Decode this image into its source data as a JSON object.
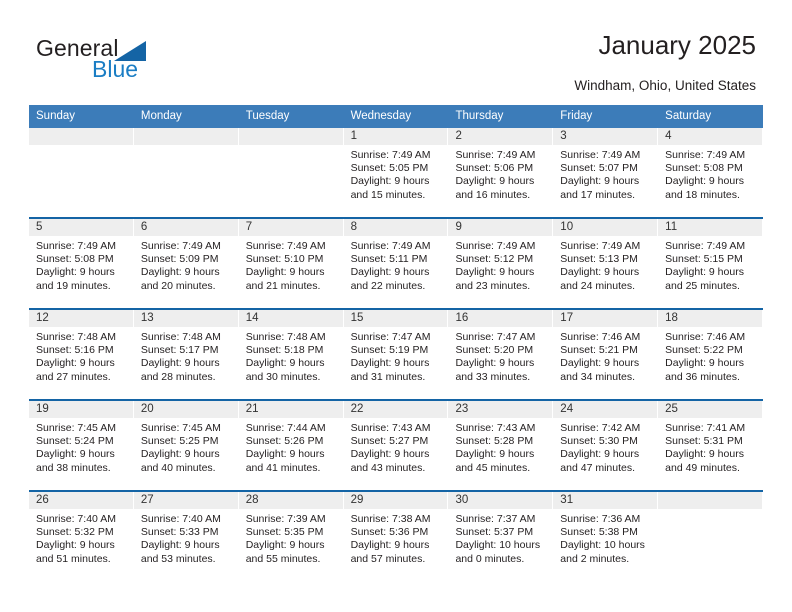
{
  "brand": {
    "name_part1": "General",
    "name_part2": "Blue",
    "triangle_color": "#1464a5",
    "blue_text_color": "#1a7dc4"
  },
  "header": {
    "title": "January 2025",
    "subtitle": "Windham, Ohio, United States"
  },
  "theme": {
    "header_bg": "#3c7cb9",
    "week_divider": "#1464a5",
    "daynum_band_bg": "#eeeeee",
    "text": "#231f20"
  },
  "calendar": {
    "day_names": [
      "Sunday",
      "Monday",
      "Tuesday",
      "Wednesday",
      "Thursday",
      "Friday",
      "Saturday"
    ],
    "weeks": [
      [
        {
          "day": "",
          "lines": []
        },
        {
          "day": "",
          "lines": []
        },
        {
          "day": "",
          "lines": []
        },
        {
          "day": "1",
          "lines": [
            "Sunrise: 7:49 AM",
            "Sunset: 5:05 PM",
            "Daylight: 9 hours",
            "and 15 minutes."
          ]
        },
        {
          "day": "2",
          "lines": [
            "Sunrise: 7:49 AM",
            "Sunset: 5:06 PM",
            "Daylight: 9 hours",
            "and 16 minutes."
          ]
        },
        {
          "day": "3",
          "lines": [
            "Sunrise: 7:49 AM",
            "Sunset: 5:07 PM",
            "Daylight: 9 hours",
            "and 17 minutes."
          ]
        },
        {
          "day": "4",
          "lines": [
            "Sunrise: 7:49 AM",
            "Sunset: 5:08 PM",
            "Daylight: 9 hours",
            "and 18 minutes."
          ]
        }
      ],
      [
        {
          "day": "5",
          "lines": [
            "Sunrise: 7:49 AM",
            "Sunset: 5:08 PM",
            "Daylight: 9 hours",
            "and 19 minutes."
          ]
        },
        {
          "day": "6",
          "lines": [
            "Sunrise: 7:49 AM",
            "Sunset: 5:09 PM",
            "Daylight: 9 hours",
            "and 20 minutes."
          ]
        },
        {
          "day": "7",
          "lines": [
            "Sunrise: 7:49 AM",
            "Sunset: 5:10 PM",
            "Daylight: 9 hours",
            "and 21 minutes."
          ]
        },
        {
          "day": "8",
          "lines": [
            "Sunrise: 7:49 AM",
            "Sunset: 5:11 PM",
            "Daylight: 9 hours",
            "and 22 minutes."
          ]
        },
        {
          "day": "9",
          "lines": [
            "Sunrise: 7:49 AM",
            "Sunset: 5:12 PM",
            "Daylight: 9 hours",
            "and 23 minutes."
          ]
        },
        {
          "day": "10",
          "lines": [
            "Sunrise: 7:49 AM",
            "Sunset: 5:13 PM",
            "Daylight: 9 hours",
            "and 24 minutes."
          ]
        },
        {
          "day": "11",
          "lines": [
            "Sunrise: 7:49 AM",
            "Sunset: 5:15 PM",
            "Daylight: 9 hours",
            "and 25 minutes."
          ]
        }
      ],
      [
        {
          "day": "12",
          "lines": [
            "Sunrise: 7:48 AM",
            "Sunset: 5:16 PM",
            "Daylight: 9 hours",
            "and 27 minutes."
          ]
        },
        {
          "day": "13",
          "lines": [
            "Sunrise: 7:48 AM",
            "Sunset: 5:17 PM",
            "Daylight: 9 hours",
            "and 28 minutes."
          ]
        },
        {
          "day": "14",
          "lines": [
            "Sunrise: 7:48 AM",
            "Sunset: 5:18 PM",
            "Daylight: 9 hours",
            "and 30 minutes."
          ]
        },
        {
          "day": "15",
          "lines": [
            "Sunrise: 7:47 AM",
            "Sunset: 5:19 PM",
            "Daylight: 9 hours",
            "and 31 minutes."
          ]
        },
        {
          "day": "16",
          "lines": [
            "Sunrise: 7:47 AM",
            "Sunset: 5:20 PM",
            "Daylight: 9 hours",
            "and 33 minutes."
          ]
        },
        {
          "day": "17",
          "lines": [
            "Sunrise: 7:46 AM",
            "Sunset: 5:21 PM",
            "Daylight: 9 hours",
            "and 34 minutes."
          ]
        },
        {
          "day": "18",
          "lines": [
            "Sunrise: 7:46 AM",
            "Sunset: 5:22 PM",
            "Daylight: 9 hours",
            "and 36 minutes."
          ]
        }
      ],
      [
        {
          "day": "19",
          "lines": [
            "Sunrise: 7:45 AM",
            "Sunset: 5:24 PM",
            "Daylight: 9 hours",
            "and 38 minutes."
          ]
        },
        {
          "day": "20",
          "lines": [
            "Sunrise: 7:45 AM",
            "Sunset: 5:25 PM",
            "Daylight: 9 hours",
            "and 40 minutes."
          ]
        },
        {
          "day": "21",
          "lines": [
            "Sunrise: 7:44 AM",
            "Sunset: 5:26 PM",
            "Daylight: 9 hours",
            "and 41 minutes."
          ]
        },
        {
          "day": "22",
          "lines": [
            "Sunrise: 7:43 AM",
            "Sunset: 5:27 PM",
            "Daylight: 9 hours",
            "and 43 minutes."
          ]
        },
        {
          "day": "23",
          "lines": [
            "Sunrise: 7:43 AM",
            "Sunset: 5:28 PM",
            "Daylight: 9 hours",
            "and 45 minutes."
          ]
        },
        {
          "day": "24",
          "lines": [
            "Sunrise: 7:42 AM",
            "Sunset: 5:30 PM",
            "Daylight: 9 hours",
            "and 47 minutes."
          ]
        },
        {
          "day": "25",
          "lines": [
            "Sunrise: 7:41 AM",
            "Sunset: 5:31 PM",
            "Daylight: 9 hours",
            "and 49 minutes."
          ]
        }
      ],
      [
        {
          "day": "26",
          "lines": [
            "Sunrise: 7:40 AM",
            "Sunset: 5:32 PM",
            "Daylight: 9 hours",
            "and 51 minutes."
          ]
        },
        {
          "day": "27",
          "lines": [
            "Sunrise: 7:40 AM",
            "Sunset: 5:33 PM",
            "Daylight: 9 hours",
            "and 53 minutes."
          ]
        },
        {
          "day": "28",
          "lines": [
            "Sunrise: 7:39 AM",
            "Sunset: 5:35 PM",
            "Daylight: 9 hours",
            "and 55 minutes."
          ]
        },
        {
          "day": "29",
          "lines": [
            "Sunrise: 7:38 AM",
            "Sunset: 5:36 PM",
            "Daylight: 9 hours",
            "and 57 minutes."
          ]
        },
        {
          "day": "30",
          "lines": [
            "Sunrise: 7:37 AM",
            "Sunset: 5:37 PM",
            "Daylight: 10 hours",
            "and 0 minutes."
          ]
        },
        {
          "day": "31",
          "lines": [
            "Sunrise: 7:36 AM",
            "Sunset: 5:38 PM",
            "Daylight: 10 hours",
            "and 2 minutes."
          ]
        },
        {
          "day": "",
          "lines": []
        }
      ]
    ]
  }
}
